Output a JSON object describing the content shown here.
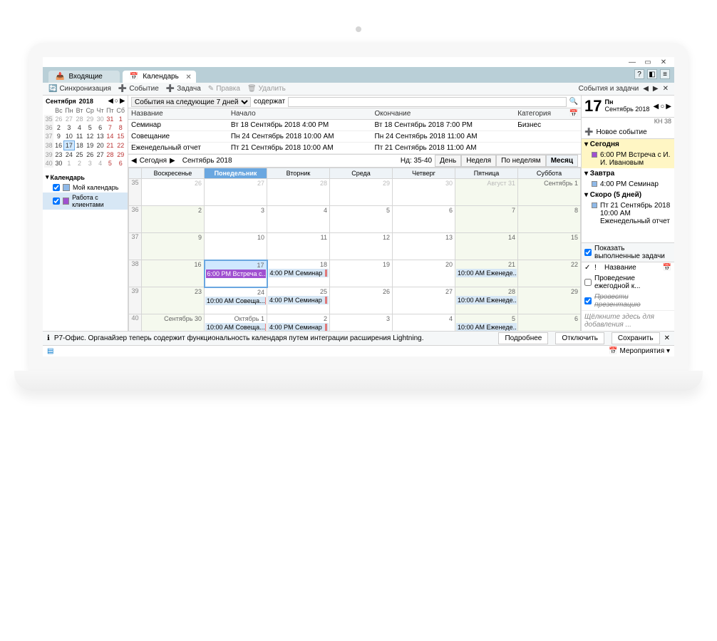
{
  "tabs": {
    "inbox": "Входящие",
    "calendar": "Календарь"
  },
  "toolbar": {
    "sync": "Синхронизация",
    "event": "Событие",
    "task": "Задача",
    "edit": "Правка",
    "delete": "Удалить",
    "sidebar_title": "События и задачи"
  },
  "minical": {
    "month": "Сентября",
    "year": "2018",
    "dow": [
      "Вс",
      "Пн",
      "Вт",
      "Ср",
      "Чт",
      "Пт",
      "Сб"
    ],
    "weeks": [
      {
        "wk": 35,
        "d": [
          26,
          27,
          28,
          29,
          30,
          31,
          1
        ],
        "dim": [
          0,
          1,
          2,
          3,
          4,
          5
        ]
      },
      {
        "wk": 36,
        "d": [
          2,
          3,
          4,
          5,
          6,
          7,
          8
        ]
      },
      {
        "wk": 37,
        "d": [
          9,
          10,
          11,
          12,
          13,
          14,
          15
        ]
      },
      {
        "wk": 38,
        "d": [
          16,
          17,
          18,
          19,
          20,
          21,
          22
        ],
        "today": 1
      },
      {
        "wk": 39,
        "d": [
          23,
          24,
          25,
          26,
          27,
          28,
          29
        ]
      },
      {
        "wk": 40,
        "d": [
          30,
          1,
          2,
          3,
          4,
          5,
          6
        ],
        "dim": [
          1,
          2,
          3,
          4,
          5,
          6
        ]
      }
    ]
  },
  "cal_list": {
    "hdr": "Календарь",
    "items": [
      {
        "label": "Мой календарь",
        "color": "#8fb9e8",
        "sel": false
      },
      {
        "label": "Работа с клиентами",
        "color": "#a050d0",
        "sel": true
      }
    ]
  },
  "filter": {
    "range": "События на следующие 7 дней",
    "contains": "содержат"
  },
  "events_table": {
    "cols": [
      "Название",
      "Начало",
      "Окончание",
      "Категория"
    ],
    "rows": [
      [
        "Семинар",
        "Вт 18 Сентябрь 2018 4:00 PM",
        "Вт 18 Сентябрь 2018 7:00 PM",
        "Бизнес"
      ],
      [
        "Совещание",
        "Пн 24 Сентябрь 2018 10:00 AM",
        "Пн 24 Сентябрь 2018 11:00 AM",
        ""
      ],
      [
        "Еженедельный отчет",
        "Пт 21 Сентябрь 2018 10:00 AM",
        "Пт 21 Сентябрь 2018 11:00 AM",
        ""
      ]
    ]
  },
  "calnav": {
    "today": "Сегодня",
    "label": "Сентябрь 2018",
    "weeks": "Нд: 35-40",
    "views": [
      "День",
      "Неделя",
      "По неделям",
      "Месяц"
    ],
    "active": 3
  },
  "grid": {
    "dow": [
      "Воскресенье",
      "Понедельник",
      "Вторник",
      "Среда",
      "Четверг",
      "Пятница",
      "Суббота"
    ],
    "current_dow": 1,
    "rows": [
      {
        "wk": 35,
        "days": [
          {
            "n": 26,
            "dim": 1
          },
          {
            "n": 27,
            "dim": 1
          },
          {
            "n": 28,
            "dim": 1
          },
          {
            "n": 29,
            "dim": 1
          },
          {
            "n": 30,
            "dim": 1
          },
          {
            "n": "Август 31",
            "dim": 1,
            "we": 1
          },
          {
            "n": "Сентябрь 1",
            "we": 1
          }
        ]
      },
      {
        "wk": 36,
        "days": [
          {
            "n": 2,
            "we": 1
          },
          {
            "n": 3
          },
          {
            "n": 4
          },
          {
            "n": 5
          },
          {
            "n": 6
          },
          {
            "n": 7,
            "we": 1
          },
          {
            "n": 8,
            "we": 1
          }
        ]
      },
      {
        "wk": 37,
        "days": [
          {
            "n": 9,
            "we": 1
          },
          {
            "n": 10
          },
          {
            "n": 11
          },
          {
            "n": 12
          },
          {
            "n": 13
          },
          {
            "n": 14,
            "we": 1
          },
          {
            "n": 15,
            "we": 1
          }
        ]
      },
      {
        "wk": 38,
        "days": [
          {
            "n": 16,
            "we": 1
          },
          {
            "n": 17,
            "today": 1,
            "ev": [
              {
                "t": "6:00 PM Встреча с...",
                "c": "purple"
              }
            ]
          },
          {
            "n": 18,
            "ev": [
              {
                "t": "4:00 PM Семинар",
                "c": "blue",
                "bar": 1
              }
            ]
          },
          {
            "n": 19
          },
          {
            "n": 20
          },
          {
            "n": 21,
            "we": 1,
            "ev": [
              {
                "t": "10:00 AM Еженеде...",
                "c": "blue"
              }
            ]
          },
          {
            "n": 22,
            "we": 1
          }
        ]
      },
      {
        "wk": 39,
        "days": [
          {
            "n": 23,
            "we": 1
          },
          {
            "n": 24,
            "ev": [
              {
                "t": "10:00 AM Совеща...",
                "c": "blue",
                "bar": 1
              }
            ]
          },
          {
            "n": 25,
            "ev": [
              {
                "t": "4:00 PM Семинар",
                "c": "blue",
                "bar": 1
              }
            ]
          },
          {
            "n": 26
          },
          {
            "n": 27
          },
          {
            "n": 28,
            "we": 1,
            "ev": [
              {
                "t": "10:00 AM Еженеде...",
                "c": "blue"
              }
            ]
          },
          {
            "n": 29,
            "we": 1
          }
        ]
      },
      {
        "wk": 40,
        "days": [
          {
            "n": "Сентябрь 30",
            "we": 1
          },
          {
            "n": "Октябрь 1",
            "ev": [
              {
                "t": "10:00 AM Совеща...",
                "c": "blue",
                "bar": 1
              }
            ]
          },
          {
            "n": 2,
            "ev": [
              {
                "t": "4:00 PM Семинар",
                "c": "blue",
                "bar": 1
              }
            ]
          },
          {
            "n": 3
          },
          {
            "n": 4
          },
          {
            "n": 5,
            "we": 1,
            "ev": [
              {
                "t": "10:00 AM Еженеде...",
                "c": "blue"
              }
            ]
          },
          {
            "n": 6,
            "we": 1
          }
        ]
      }
    ]
  },
  "rightpanel": {
    "daynum": "17",
    "dow": "Пн",
    "sub1": "Сентябрь 2018",
    "sub2": "КН 38",
    "new_event": "Новое событие",
    "groups": [
      {
        "label": "Сегодня",
        "hl": true,
        "items": [
          {
            "color": "#a050d0",
            "text": "6:00 PM Встреча с И. И. Ивановым",
            "sel": true
          }
        ]
      },
      {
        "label": "Завтра",
        "items": [
          {
            "color": "#8fb9e8",
            "text": "4:00 PM Семинар"
          }
        ]
      },
      {
        "label": "Скоро (5 дней)",
        "items": [
          {
            "color": "#8fb9e8",
            "text": "Пт 21 Сентябрь 2018 10:00 AM Еженедельный отчет"
          }
        ]
      }
    ],
    "tasks": {
      "show_done": "Показать выполненные задачи",
      "name_col": "Название",
      "items": [
        {
          "done": false,
          "text": "Проведение ежегодной к..."
        },
        {
          "done": true,
          "text": "Провести презентацию"
        }
      ],
      "add": "Щёлкните здесь для добавления ..."
    }
  },
  "notif": {
    "text": "Р7-Офис. Органайзер теперь содержит функциональность календаря путем интеграции расширения Lightning.",
    "more": "Подробнее",
    "disable": "Отключить",
    "save": "Сохранить"
  },
  "status": {
    "events": "Мероприятия"
  }
}
